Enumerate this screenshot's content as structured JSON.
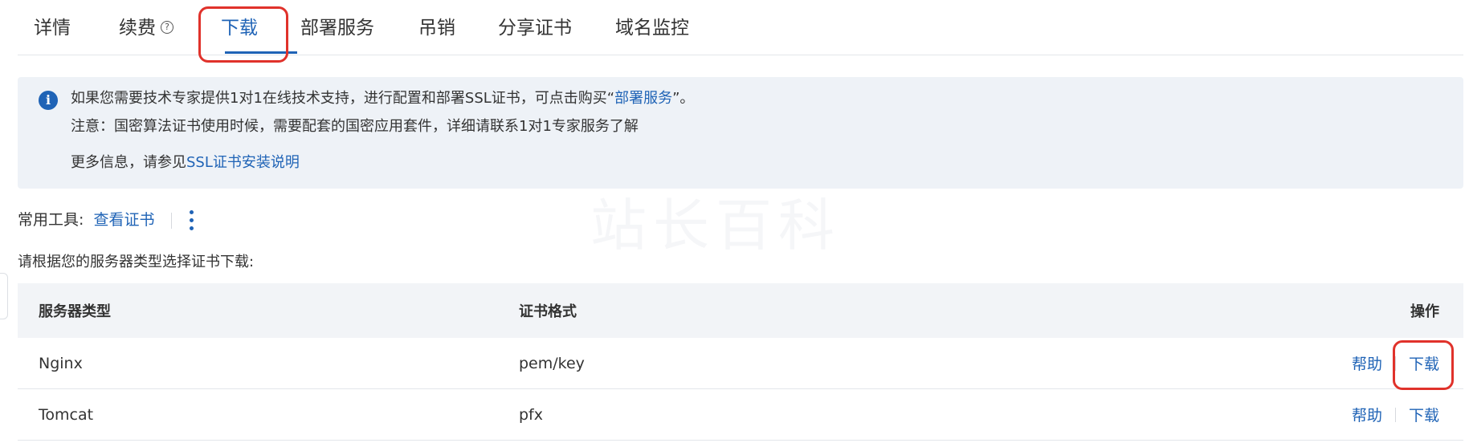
{
  "tabs": [
    {
      "label": "详情"
    },
    {
      "label": "续费"
    },
    {
      "label": "下载"
    },
    {
      "label": "部署服务"
    },
    {
      "label": "吊销"
    },
    {
      "label": "分享证书"
    },
    {
      "label": "域名监控"
    }
  ],
  "active_tab": "下载",
  "notice": {
    "line1_prefix": "如果您需要技术专家提供1对1在线技术支持，进行配置和部署SSL证书，可点击购买“",
    "line1_link": "部署服务",
    "line1_suffix": "”。",
    "line2": "注意：国密算法证书使用时候，需要配套的国密应用套件，详细请联系1对1专家服务了解",
    "line3_prefix": "更多信息，请参见",
    "line3_link": "SSL证书安装说明"
  },
  "tools": {
    "label": "常用工具:",
    "view_cert": "查看证书"
  },
  "prompt": "请根据您的服务器类型选择证书下载:",
  "table": {
    "headers": {
      "type": "服务器类型",
      "format": "证书格式",
      "ops": "操作"
    },
    "rows": [
      {
        "type": "Nginx",
        "format": "pem/key",
        "help": "帮助",
        "download": "下载"
      },
      {
        "type": "Tomcat",
        "format": "pfx",
        "help": "帮助",
        "download": "下载"
      }
    ]
  },
  "watermark": "站长百科",
  "colors": {
    "accent": "#1f63b6",
    "highlight_border": "#e0322b",
    "notice_bg": "#eef2f7",
    "header_bg": "#f2f4f7"
  }
}
